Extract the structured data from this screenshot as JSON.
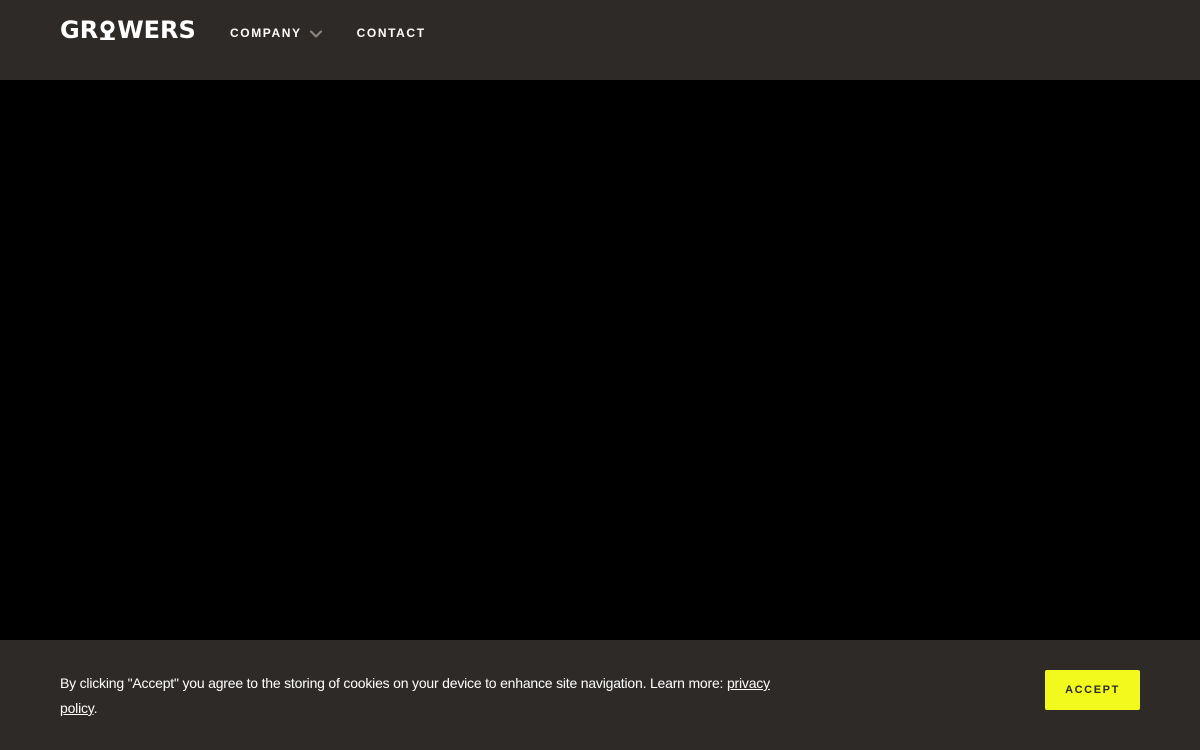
{
  "header": {
    "logo": {
      "before": "GR",
      "after": "WERS",
      "full_text": "GROWERS"
    },
    "nav": {
      "company_label": "COMPANY",
      "contact_label": "CONTACT"
    }
  },
  "cookie_banner": {
    "text_before_link": "By clicking \"Accept\" you agree to the storing of cookies on your device to enhance site navigation. Learn more: ",
    "link_label": "privacy policy",
    "text_after_link": ".",
    "accept_label": "ACCEPT"
  },
  "colors": {
    "header_background": "#2e2a27",
    "page_background": "#000000",
    "accent_yellow": "#f2fa1d",
    "text_light": "#ffffff"
  },
  "icons": {
    "company_dropdown": "chevron-down-icon",
    "logo_o": "pin-o-logo-glyph"
  }
}
